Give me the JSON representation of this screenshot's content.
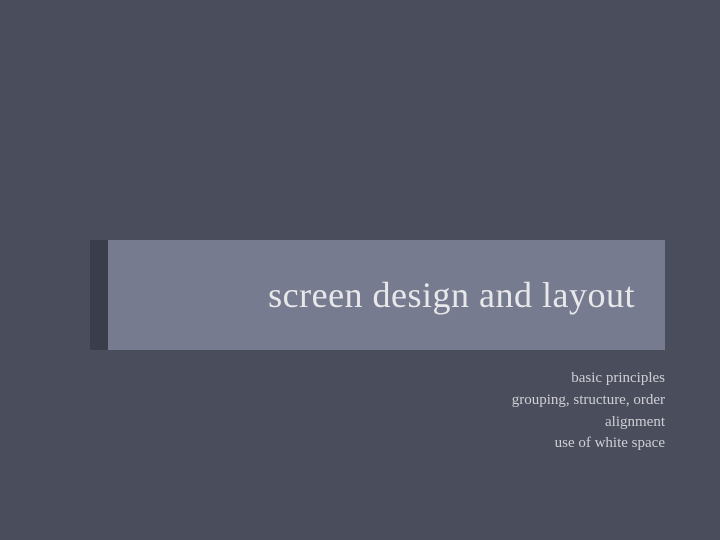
{
  "slide": {
    "title": "screen design and layout",
    "subtitles": {
      "line1": "basic principles",
      "line2": "grouping, structure, order",
      "line3": "alignment",
      "line4": "use of white space"
    }
  },
  "colors": {
    "background": "#4a4d5c",
    "band": "#767b8f",
    "bandAccent": "#3a3d4a",
    "titleText": "#e8e8ea",
    "subtitleText": "#cfcfd4"
  }
}
